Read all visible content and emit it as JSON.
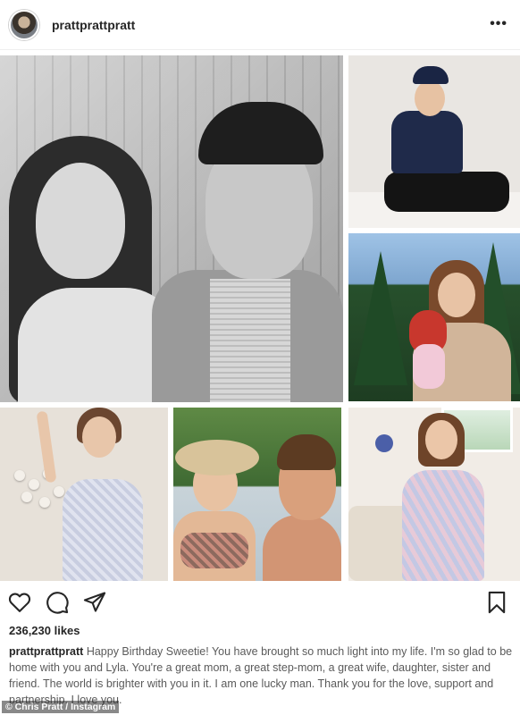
{
  "header": {
    "username": "prattprattpratt",
    "more_label": "•••"
  },
  "post": {
    "likes": "236,230 likes",
    "caption_username": "prattprattpratt",
    "caption_text": "Happy Birthday Sweetie! You have brought so much light into my life. I'm so glad to be home with you and Lyla. You're a great mom, a great step-mom, a great wife, daughter, sister and friend. The world is brighter with you in it. I am one lucky man. Thank you for the love, support and partnership. I love you."
  },
  "credit": "© Chris Pratt / Instagram",
  "icons": {
    "like": "heart-icon",
    "comment": "comment-icon",
    "share": "share-icon",
    "save": "bookmark-icon",
    "more": "more-icon"
  },
  "colors": {
    "text": "#262626",
    "caption_text": "#5a5a5a",
    "divider": "#efefef"
  }
}
